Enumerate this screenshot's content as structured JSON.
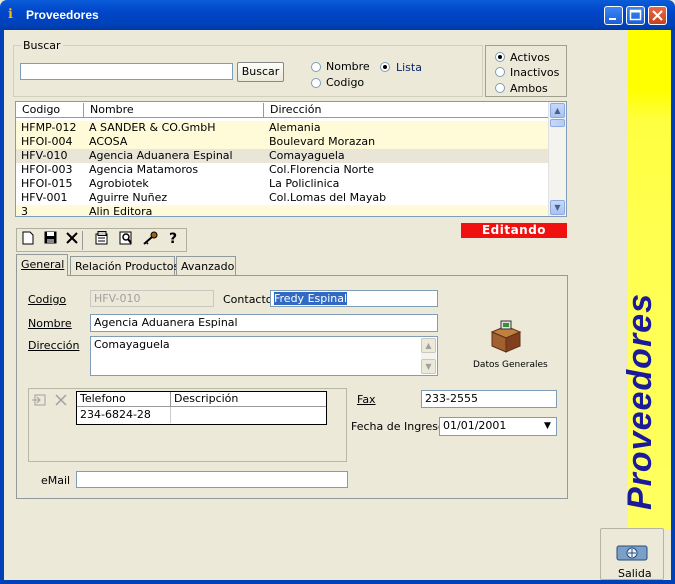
{
  "window": {
    "title": "Proveedores"
  },
  "search": {
    "legend": "Buscar",
    "value": "",
    "button_label": "Buscar",
    "by_name_label": "Nombre",
    "by_code_label": "Codigo",
    "list_label": "Lista",
    "selected_mode": "Lista"
  },
  "filter": {
    "active_label": "Activos",
    "inactive_label": "Inactivos",
    "both_label": "Ambos",
    "selected": "Activos"
  },
  "grid": {
    "columns": [
      "Codigo",
      "Nombre",
      "Dirección"
    ],
    "rows": [
      {
        "code": "HFMP-012",
        "name": "A SANDER & CO.GmbH",
        "address": "Alemania"
      },
      {
        "code": "HFOI-004",
        "name": "ACOSA",
        "address": "Boulevard Morazan"
      },
      {
        "code": "HFV-010",
        "name": "Agencia Aduanera Espinal",
        "address": "Comayaguela"
      },
      {
        "code": "HFOI-003",
        "name": "Agencia Matamoros",
        "address": "Col.Florencia Norte"
      },
      {
        "code": "HFOI-015",
        "name": "Agrobiotek",
        "address": "La Policlinica"
      },
      {
        "code": "HFV-001",
        "name": "Aguirre Nuñez",
        "address": "Col.Lomas del Mayab"
      },
      {
        "code": "3",
        "name": "Alin Editora",
        "address": ""
      }
    ]
  },
  "status": {
    "editing_label": "Editando",
    "color": "#f01010"
  },
  "tabs": [
    {
      "label": "General"
    },
    {
      "label": "Relación Productos"
    },
    {
      "label": "Avanzado"
    }
  ],
  "form": {
    "code_label": "Codigo",
    "code_value": "HFV-010",
    "contact_label": "Contacto",
    "contact_value": "Fredy Espinal",
    "name_label": "Nombre",
    "name_value": "Agencia Aduanera Espinal",
    "address_label": "Dirección",
    "address_value": "Comayaguela",
    "general_data_label": "Datos Generales",
    "phone_columns": [
      "Telefono",
      "Descripción"
    ],
    "phones": [
      {
        "number": "234-6824-28",
        "description": ""
      }
    ],
    "fax_label": "Fax",
    "fax_value": "233-2555",
    "date_label": "Fecha de Ingreso:",
    "date_value": "01/01/2001",
    "email_label": "eMail",
    "email_value": ""
  },
  "sidebar": {
    "title": "Proveedores",
    "exit_label": "Salida"
  },
  "colors": {
    "titlebar": "#0046c8",
    "sidebar": "#ffff00",
    "sidebar_text": "#1a1a9a",
    "selection": "#316ac5"
  }
}
